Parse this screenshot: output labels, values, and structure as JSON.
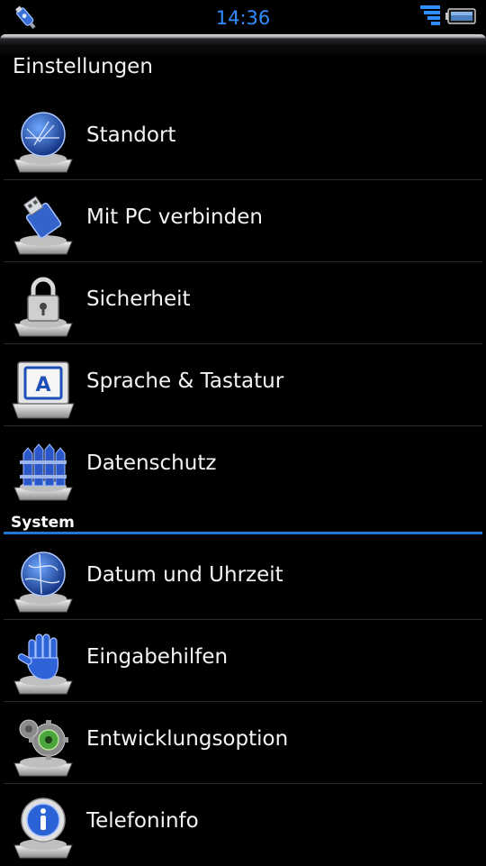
{
  "status_bar": {
    "time": "14:36",
    "icons": [
      "usb-debug-icon",
      "signal-icon",
      "battery-icon"
    ]
  },
  "header": {
    "title": "Einstellungen"
  },
  "items_top": [
    {
      "label": "Standort",
      "icon": "globe-icon"
    },
    {
      "label": "Mit PC verbinden",
      "icon": "usb-connect-icon"
    },
    {
      "label": "Sicherheit",
      "icon": "padlock-icon"
    },
    {
      "label": "Sprache & Tastatur",
      "icon": "keyboard-key-icon",
      "icon_letter": "A"
    },
    {
      "label": "Datenschutz",
      "icon": "fence-icon"
    }
  ],
  "section": {
    "label": "System"
  },
  "items_system": [
    {
      "label": "Datum und Uhrzeit",
      "icon": "globe-icon"
    },
    {
      "label": "Eingabehilfen",
      "icon": "hand-icon"
    },
    {
      "label": "Entwicklungsoption",
      "icon": "gears-icon"
    },
    {
      "label": "Telefoninfo",
      "icon": "info-icon"
    }
  ],
  "colors": {
    "accent": "#1f77d6",
    "clock": "#2f8dff",
    "text": "#f4f4f4",
    "background": "#000000"
  }
}
